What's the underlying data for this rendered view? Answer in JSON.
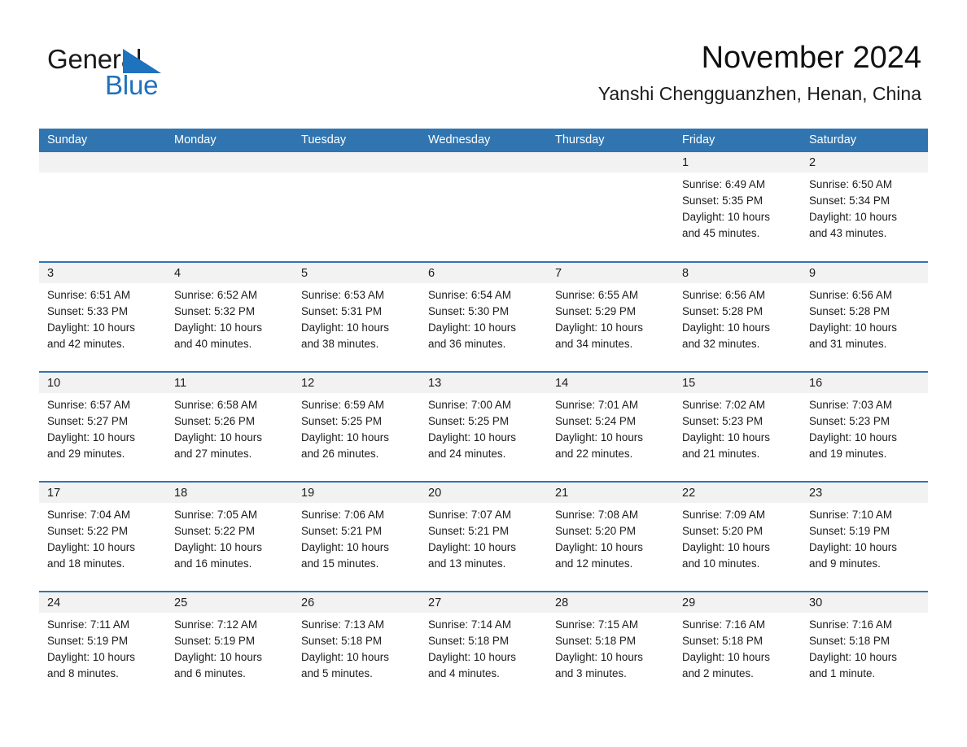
{
  "brand": {
    "name_part1": "General",
    "name_part2": "Blue",
    "triangle_color": "#1f72bd",
    "text_color": "#1a1a1a"
  },
  "header": {
    "title": "November 2024",
    "subtitle": "Yanshi Chengguanzhen, Henan, China"
  },
  "theme": {
    "header_blue": "#3175b0",
    "daynum_band": "#f2f2f2",
    "separator_blue": "#3175b0",
    "text": "#1c1c1c"
  },
  "weekday_headers": [
    "Sunday",
    "Monday",
    "Tuesday",
    "Wednesday",
    "Thursday",
    "Friday",
    "Saturday"
  ],
  "calendar": {
    "month": "November",
    "year": "2024",
    "weeks": [
      [
        {
          "day": "",
          "lines": []
        },
        {
          "day": "",
          "lines": []
        },
        {
          "day": "",
          "lines": []
        },
        {
          "day": "",
          "lines": []
        },
        {
          "day": "",
          "lines": []
        },
        {
          "day": "1",
          "lines": [
            "Sunrise: 6:49 AM",
            "Sunset: 5:35 PM",
            "Daylight: 10 hours",
            "and 45 minutes."
          ]
        },
        {
          "day": "2",
          "lines": [
            "Sunrise: 6:50 AM",
            "Sunset: 5:34 PM",
            "Daylight: 10 hours",
            "and 43 minutes."
          ]
        }
      ],
      [
        {
          "day": "3",
          "lines": [
            "Sunrise: 6:51 AM",
            "Sunset: 5:33 PM",
            "Daylight: 10 hours",
            "and 42 minutes."
          ]
        },
        {
          "day": "4",
          "lines": [
            "Sunrise: 6:52 AM",
            "Sunset: 5:32 PM",
            "Daylight: 10 hours",
            "and 40 minutes."
          ]
        },
        {
          "day": "5",
          "lines": [
            "Sunrise: 6:53 AM",
            "Sunset: 5:31 PM",
            "Daylight: 10 hours",
            "and 38 minutes."
          ]
        },
        {
          "day": "6",
          "lines": [
            "Sunrise: 6:54 AM",
            "Sunset: 5:30 PM",
            "Daylight: 10 hours",
            "and 36 minutes."
          ]
        },
        {
          "day": "7",
          "lines": [
            "Sunrise: 6:55 AM",
            "Sunset: 5:29 PM",
            "Daylight: 10 hours",
            "and 34 minutes."
          ]
        },
        {
          "day": "8",
          "lines": [
            "Sunrise: 6:56 AM",
            "Sunset: 5:28 PM",
            "Daylight: 10 hours",
            "and 32 minutes."
          ]
        },
        {
          "day": "9",
          "lines": [
            "Sunrise: 6:56 AM",
            "Sunset: 5:28 PM",
            "Daylight: 10 hours",
            "and 31 minutes."
          ]
        }
      ],
      [
        {
          "day": "10",
          "lines": [
            "Sunrise: 6:57 AM",
            "Sunset: 5:27 PM",
            "Daylight: 10 hours",
            "and 29 minutes."
          ]
        },
        {
          "day": "11",
          "lines": [
            "Sunrise: 6:58 AM",
            "Sunset: 5:26 PM",
            "Daylight: 10 hours",
            "and 27 minutes."
          ]
        },
        {
          "day": "12",
          "lines": [
            "Sunrise: 6:59 AM",
            "Sunset: 5:25 PM",
            "Daylight: 10 hours",
            "and 26 minutes."
          ]
        },
        {
          "day": "13",
          "lines": [
            "Sunrise: 7:00 AM",
            "Sunset: 5:25 PM",
            "Daylight: 10 hours",
            "and 24 minutes."
          ]
        },
        {
          "day": "14",
          "lines": [
            "Sunrise: 7:01 AM",
            "Sunset: 5:24 PM",
            "Daylight: 10 hours",
            "and 22 minutes."
          ]
        },
        {
          "day": "15",
          "lines": [
            "Sunrise: 7:02 AM",
            "Sunset: 5:23 PM",
            "Daylight: 10 hours",
            "and 21 minutes."
          ]
        },
        {
          "day": "16",
          "lines": [
            "Sunrise: 7:03 AM",
            "Sunset: 5:23 PM",
            "Daylight: 10 hours",
            "and 19 minutes."
          ]
        }
      ],
      [
        {
          "day": "17",
          "lines": [
            "Sunrise: 7:04 AM",
            "Sunset: 5:22 PM",
            "Daylight: 10 hours",
            "and 18 minutes."
          ]
        },
        {
          "day": "18",
          "lines": [
            "Sunrise: 7:05 AM",
            "Sunset: 5:22 PM",
            "Daylight: 10 hours",
            "and 16 minutes."
          ]
        },
        {
          "day": "19",
          "lines": [
            "Sunrise: 7:06 AM",
            "Sunset: 5:21 PM",
            "Daylight: 10 hours",
            "and 15 minutes."
          ]
        },
        {
          "day": "20",
          "lines": [
            "Sunrise: 7:07 AM",
            "Sunset: 5:21 PM",
            "Daylight: 10 hours",
            "and 13 minutes."
          ]
        },
        {
          "day": "21",
          "lines": [
            "Sunrise: 7:08 AM",
            "Sunset: 5:20 PM",
            "Daylight: 10 hours",
            "and 12 minutes."
          ]
        },
        {
          "day": "22",
          "lines": [
            "Sunrise: 7:09 AM",
            "Sunset: 5:20 PM",
            "Daylight: 10 hours",
            "and 10 minutes."
          ]
        },
        {
          "day": "23",
          "lines": [
            "Sunrise: 7:10 AM",
            "Sunset: 5:19 PM",
            "Daylight: 10 hours",
            "and 9 minutes."
          ]
        }
      ],
      [
        {
          "day": "24",
          "lines": [
            "Sunrise: 7:11 AM",
            "Sunset: 5:19 PM",
            "Daylight: 10 hours",
            "and 8 minutes."
          ]
        },
        {
          "day": "25",
          "lines": [
            "Sunrise: 7:12 AM",
            "Sunset: 5:19 PM",
            "Daylight: 10 hours",
            "and 6 minutes."
          ]
        },
        {
          "day": "26",
          "lines": [
            "Sunrise: 7:13 AM",
            "Sunset: 5:18 PM",
            "Daylight: 10 hours",
            "and 5 minutes."
          ]
        },
        {
          "day": "27",
          "lines": [
            "Sunrise: 7:14 AM",
            "Sunset: 5:18 PM",
            "Daylight: 10 hours",
            "and 4 minutes."
          ]
        },
        {
          "day": "28",
          "lines": [
            "Sunrise: 7:15 AM",
            "Sunset: 5:18 PM",
            "Daylight: 10 hours",
            "and 3 minutes."
          ]
        },
        {
          "day": "29",
          "lines": [
            "Sunrise: 7:16 AM",
            "Sunset: 5:18 PM",
            "Daylight: 10 hours",
            "and 2 minutes."
          ]
        },
        {
          "day": "30",
          "lines": [
            "Sunrise: 7:16 AM",
            "Sunset: 5:18 PM",
            "Daylight: 10 hours",
            "and 1 minute."
          ]
        }
      ]
    ]
  }
}
